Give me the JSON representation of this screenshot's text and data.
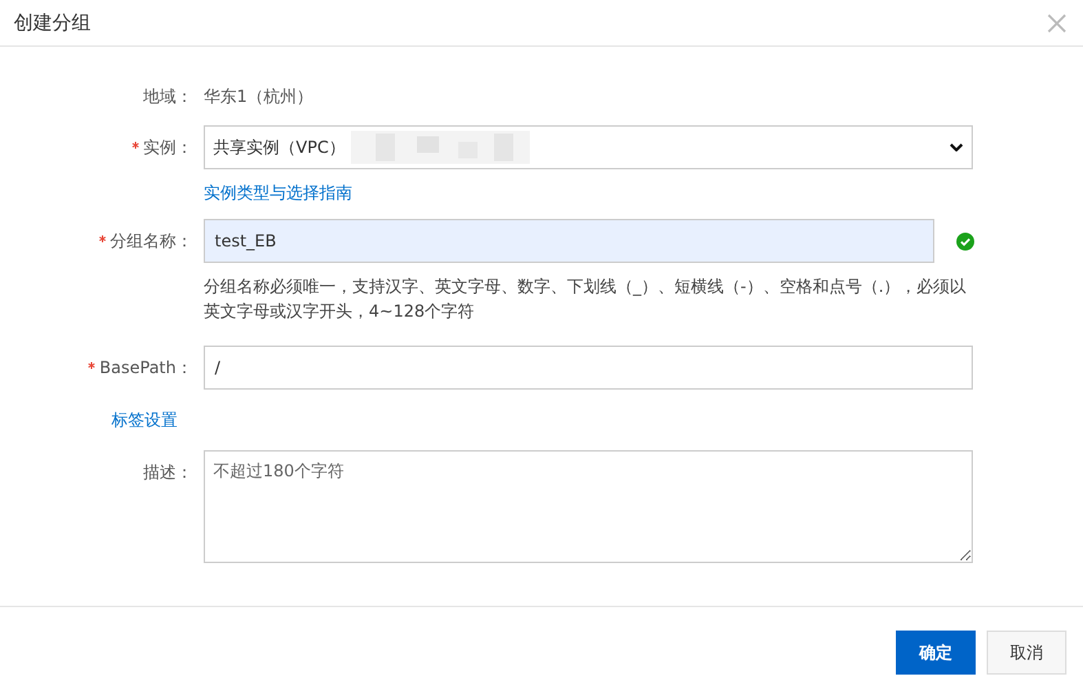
{
  "dialog": {
    "title": "创建分组"
  },
  "form": [
    {
      "kind": "static",
      "label": "地域：",
      "required": false,
      "value": "华东1（杭州）"
    },
    {
      "kind": "select",
      "label": "实例：",
      "required": true,
      "value": "共享实例（VPC）",
      "link": "实例类型与选择指南"
    },
    {
      "kind": "input",
      "label": "分组名称：",
      "required": true,
      "value": "test_EB",
      "valid": true,
      "hint": "分组名称必须唯一，支持汉字、英文字母、数字、下划线（_）、短横线（-）、空格和点号（.），必须以英文字母或汉字开头，4~128个字符"
    },
    {
      "kind": "input",
      "label": "BasePath：",
      "required": true,
      "value": "/",
      "valid": false
    },
    {
      "kind": "link",
      "label": "标签设置"
    },
    {
      "kind": "textarea",
      "label": "描述：",
      "required": false,
      "placeholder": "不超过180个字符"
    }
  ],
  "buttons": [
    {
      "label": "确定",
      "primary": true
    },
    {
      "label": "取消",
      "primary": false
    }
  ]
}
